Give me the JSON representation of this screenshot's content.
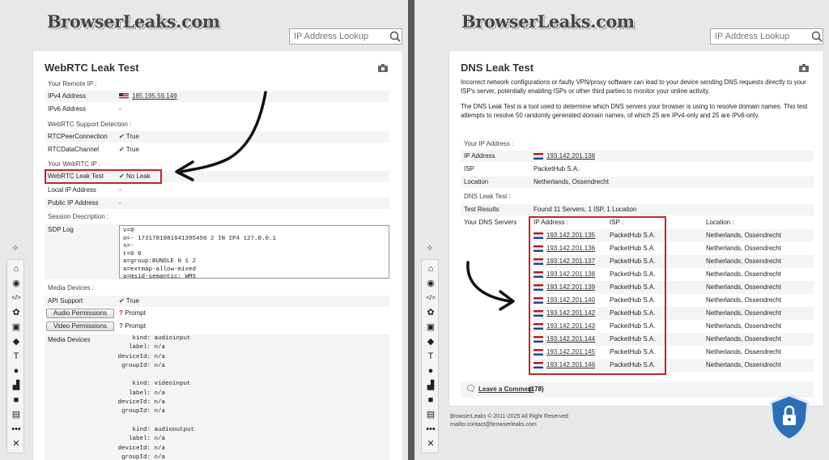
{
  "left": {
    "logo": "BrowserLeaks.com",
    "search_placeholder": "IP Address Lookup",
    "title": "WebRTC Leak Test",
    "sections": {
      "remote_ip": "Your Remote IP :",
      "support": "WebRTC Support Detection :",
      "your_ip": "Your WebRTC IP :",
      "session": "Session Description :",
      "media": "Media Devices :"
    },
    "rows": {
      "ipv4_label": "IPv4 Address",
      "ipv4_value": "185.195.59.149",
      "ipv6_label": "IPv6 Address",
      "ipv6_value": "-",
      "rtcpeer_label": "RTCPeerConnection",
      "rtcpeer_value": "True",
      "rtcdata_label": "RTCDataChannel",
      "rtcdata_value": "True",
      "leak_label": "WebRTC Leak Test",
      "leak_value": "No Leak",
      "local_label": "Local IP Address",
      "local_value": "-",
      "public_label": "Public IP Address",
      "public_value": "-",
      "sdp_label": "SDP Log",
      "api_label": "API Support",
      "api_value": "True",
      "audio_btn": "Audio Permissions",
      "audio_value": "Prompt",
      "video_btn": "Video Permissions",
      "video_value": "Prompt",
      "devices_label": "Media Devices"
    },
    "sdp_log": "v=0\no=- 1731781981641395456 2 IN IP4 127.0.0.1\ns=-\nt=0 0\na=group:BUNDLE 0 1 2\na=extmap-allow-mixed\na=msid-semantic: WMS",
    "devices_text": "     kind: audioinput\n    label: n/a\n deviceId: n/a\n  groupId: n/a\n\n     kind: videoinput\n    label: n/a\n deviceId: n/a\n  groupId: n/a\n\n     kind: audiooutput\n    label: n/a\n deviceId: n/a\n  groupId: n/a"
  },
  "right": {
    "logo": "BrowserLeaks.com",
    "search_placeholder": "IP Address Lookup",
    "title": "DNS Leak Test",
    "intro1": "Incorrect network configurations or faulty VPN/proxy software can lead to your device sending DNS requests directly to your ISP's server, potentially enabling ISPs or other third parties to monitor your online activity.",
    "intro2": "The DNS Leak Test is a tool used to determine which DNS servers your browser is using to resolve domain names. This test attempts to resolve 50 randomly generated domain names, of which 25 are IPv4-only and 25 are IPv6-only.",
    "sections": {
      "your_ip": "Your IP Address :",
      "dns_test": "DNS Leak Test :"
    },
    "rows": {
      "ip_label": "IP Address",
      "ip_value": "193.142.201.138",
      "isp_label": "ISP",
      "isp_value": "PacketHub S.A.",
      "loc_label": "Location",
      "loc_value": "Netherlands, Ossendrecht",
      "results_label": "Test Results",
      "results_value": "Found 11 Servers, 1 ISP, 1 Location",
      "servers_label": "Your DNS Servers"
    },
    "dns_headers": [
      "IP Address :",
      "ISP :",
      "Location :"
    ],
    "dns_servers": [
      {
        "ip": "193.142.201.135",
        "isp": "PacketHub S.A.",
        "loc": "Netherlands, Ossendrecht"
      },
      {
        "ip": "193.142.201.136",
        "isp": "PacketHub S.A.",
        "loc": "Netherlands, Ossendrecht"
      },
      {
        "ip": "193.142.201.137",
        "isp": "PacketHub S.A.",
        "loc": "Netherlands, Ossendrecht"
      },
      {
        "ip": "193.142.201.138",
        "isp": "PacketHub S.A.",
        "loc": "Netherlands, Ossendrecht"
      },
      {
        "ip": "193.142.201.139",
        "isp": "PacketHub S.A.",
        "loc": "Netherlands, Ossendrecht"
      },
      {
        "ip": "193.142.201.140",
        "isp": "PacketHub S.A.",
        "loc": "Netherlands, Ossendrecht"
      },
      {
        "ip": "193.142.201.142",
        "isp": "PacketHub S.A.",
        "loc": "Netherlands, Ossendrecht"
      },
      {
        "ip": "193.142.201.143",
        "isp": "PacketHub S.A.",
        "loc": "Netherlands, Ossendrecht"
      },
      {
        "ip": "193.142.201.144",
        "isp": "PacketHub S.A.",
        "loc": "Netherlands, Ossendrecht"
      },
      {
        "ip": "193.142.201.145",
        "isp": "PacketHub S.A.",
        "loc": "Netherlands, Ossendrecht"
      },
      {
        "ip": "193.142.201.146",
        "isp": "PacketHub S.A.",
        "loc": "Netherlands, Ossendrecht"
      }
    ],
    "comment_link": "Leave a Comment",
    "comment_count": "(178)",
    "footer_copy": "BrowserLeaks © 2011-2025 All Right Reserved",
    "footer_mail": "mailto:contact@browserleaks.com"
  },
  "icons": {
    "sidebar": [
      "home-icon",
      "broadcast-icon",
      "code-icon",
      "puzzle-icon",
      "image-icon",
      "cube-icon",
      "text-height-icon",
      "map-pin-icon",
      "bars-icon",
      "lock-icon",
      "wall-icon",
      "more-icon",
      "tools-icon"
    ],
    "accent_red": "#c0262a"
  }
}
